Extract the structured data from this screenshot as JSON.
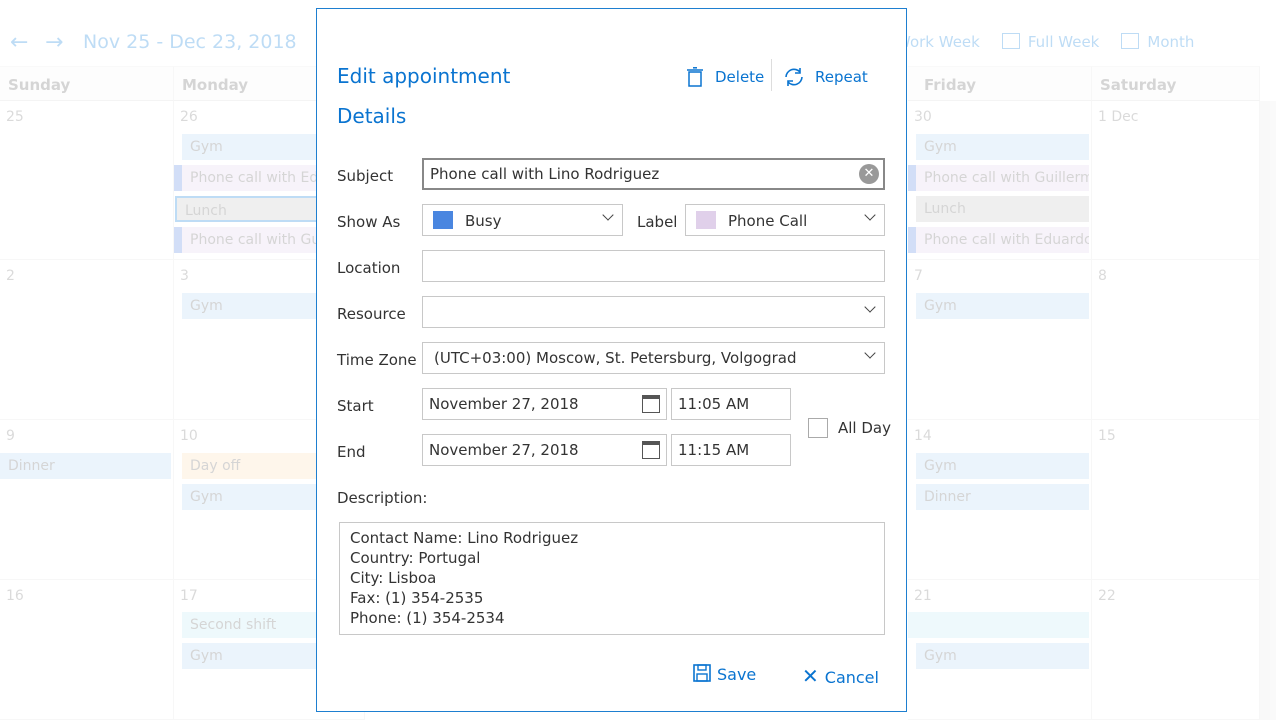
{
  "calendar": {
    "range": "Nov 25 - Dec 23, 2018",
    "views": [
      "Work Week",
      "Full Week",
      "Month"
    ],
    "days": [
      "Sunday",
      "Monday",
      "Friday",
      "Saturday"
    ],
    "dates": {
      "r1": [
        "25",
        "26",
        "30",
        "1 Dec"
      ],
      "r2": [
        "2",
        "3",
        "7",
        "8"
      ],
      "r3": [
        "9",
        "10",
        "14",
        "15"
      ],
      "r4": [
        "16",
        "17",
        "21",
        "22"
      ]
    },
    "events": {
      "gym": "Gym",
      "call_edu": "Phone call with Edu",
      "lunch": "Lunch",
      "call_gui": "Phone call with Gui",
      "call_guillerm": "Phone call with Guillerm",
      "call_eduardo": "Phone call with Eduardc",
      "dinner": "Dinner",
      "dayoff": "Day off",
      "shift": "Second shift"
    }
  },
  "dialog": {
    "title": "Edit appointment",
    "delete": "Delete",
    "repeat": "Repeat",
    "section": "Details",
    "subject_label": "Subject",
    "subject": "Phone call with Lino Rodriguez",
    "showas_label": "Show As",
    "showas": "Busy",
    "showas_color": "#4a86e0",
    "label_label": "Label",
    "label": "Phone Call",
    "label_color": "#e0d0ea",
    "location_label": "Location",
    "location": "",
    "resource_label": "Resource",
    "resource": "",
    "tz_label": "Time Zone",
    "tz": "(UTC+03:00) Moscow, St. Petersburg, Volgograd",
    "start_label": "Start",
    "start_date": "November 27, 2018",
    "start_time": "11:05 AM",
    "end_label": "End",
    "end_date": "November 27, 2018",
    "end_time": "11:15 AM",
    "allday": "All Day",
    "desc_label": "Description:",
    "desc": [
      "Contact Name: Lino Rodriguez",
      "Country: Portugal",
      "City: Lisboa",
      "Fax: (1) 354-2535",
      "Phone: (1) 354-2534"
    ],
    "save": "Save",
    "cancel": "Cancel"
  }
}
